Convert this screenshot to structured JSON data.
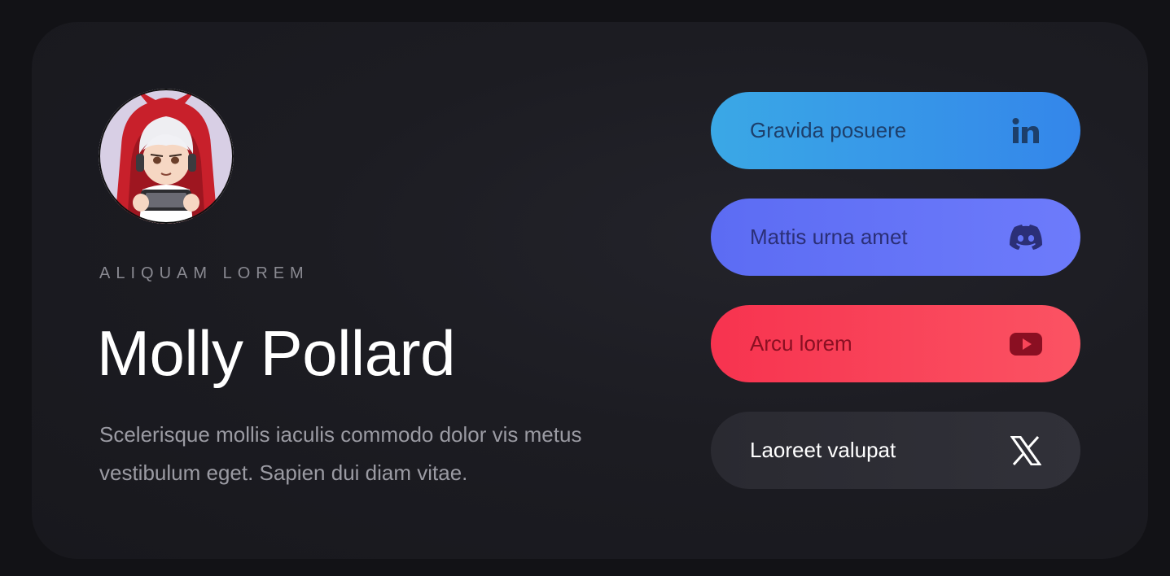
{
  "profile": {
    "eyebrow": "ALIQUAM LOREM",
    "name": "Molly Pollard",
    "description": "Scelerisque mollis iaculis commodo dolor vis metus vestibulum eget. Sapien dui diam vitae."
  },
  "links": [
    {
      "label": "Gravida posuere",
      "icon": "linkedin-icon"
    },
    {
      "label": "Mattis urna amet",
      "icon": "discord-icon"
    },
    {
      "label": "Arcu lorem",
      "icon": "youtube-icon"
    },
    {
      "label": "Laoreet valupat",
      "icon": "x-icon"
    }
  ],
  "colors": {
    "background": "#121216",
    "card": "#1c1c22",
    "linkedin": "#3aa8e6",
    "discord": "#5c6cf3",
    "youtube": "#f7334f",
    "x": "#2a2a31"
  }
}
